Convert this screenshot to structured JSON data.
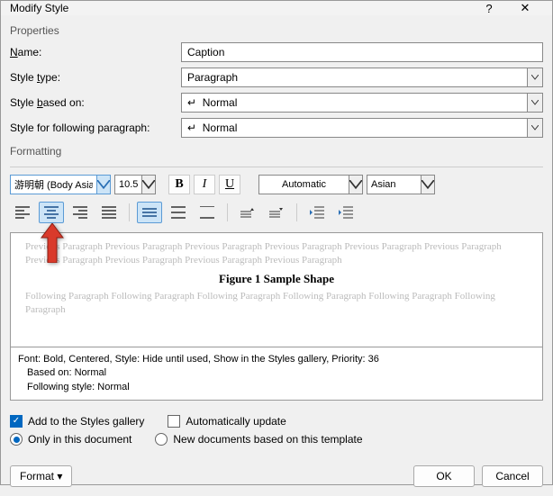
{
  "titlebar": {
    "title": "Modify Style",
    "help": "?",
    "close": "✕"
  },
  "sections": {
    "properties": "Properties",
    "formatting": "Formatting"
  },
  "labels": {
    "name_pre": "",
    "name_u": "N",
    "name_post": "ame:",
    "styletype_pre": "Style ",
    "styletype_u": "t",
    "styletype_post": "ype:",
    "basedon_pre": "Style ",
    "basedon_u": "b",
    "basedon_post": "ased on:",
    "following_pre": "Style for following paragraph:"
  },
  "fields": {
    "name": "Caption",
    "style_type": "Paragraph",
    "based_on": "↵  Normal",
    "following": "↵  Normal"
  },
  "formatting": {
    "font": "游明朝 (Body Asia",
    "size": "10.5",
    "bold": "B",
    "italic": "I",
    "underline": "U",
    "color": "Automatic",
    "script": "Asian"
  },
  "preview": {
    "before": "Previous Paragraph Previous Paragraph Previous Paragraph Previous Paragraph Previous Paragraph Previous Paragraph Previous Paragraph Previous Paragraph Previous Paragraph Previous Paragraph",
    "title": "Figure 1 Sample Shape",
    "after": "Following Paragraph Following Paragraph Following Paragraph Following Paragraph Following Paragraph Following Paragraph"
  },
  "summary": {
    "line1": "Font: Bold, Centered, Style: Hide until used, Show in the Styles gallery, Priority: 36",
    "line2": "Based on: Normal",
    "line3": "Following style: Normal"
  },
  "checks": {
    "add_gallery": "Add to the Styles gallery",
    "auto_update": "Automatically update",
    "only_doc": "Only in this document",
    "new_docs": "New documents based on this template"
  },
  "buttons": {
    "format": "Format ▾",
    "ok": "OK",
    "cancel": "Cancel"
  }
}
